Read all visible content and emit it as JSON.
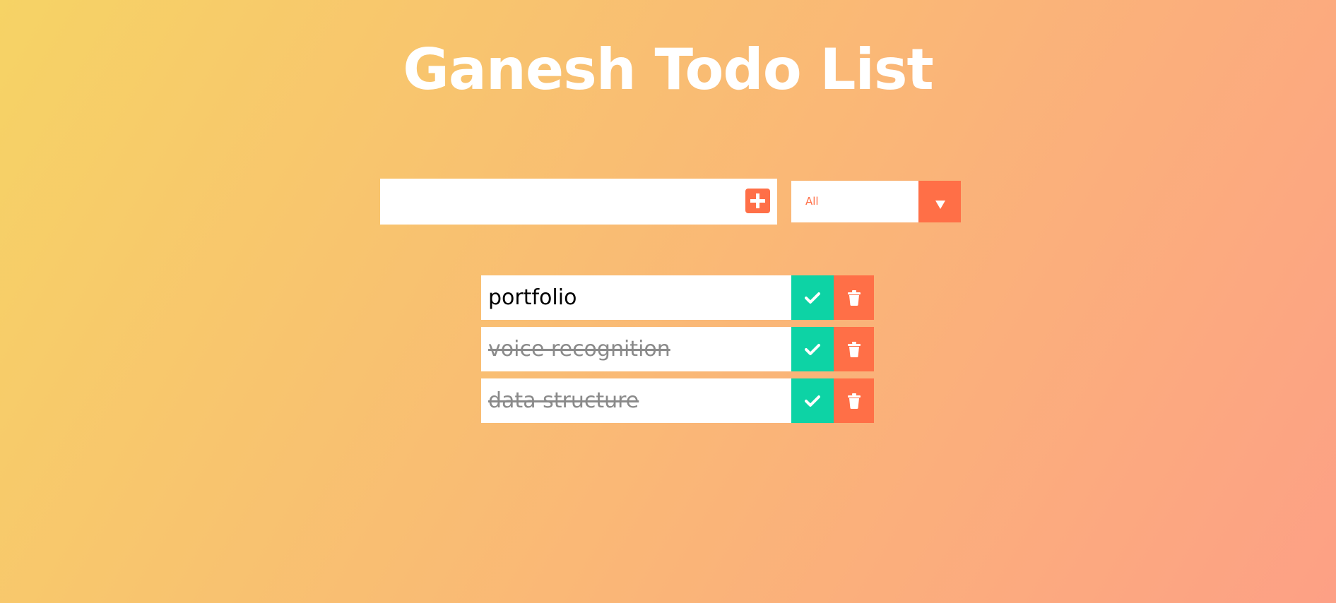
{
  "header": {
    "title": "Ganesh Todo List"
  },
  "form": {
    "input_value": "",
    "input_placeholder": "",
    "add_icon": "plus-icon"
  },
  "filter": {
    "selected": "All",
    "arrow_icon": "caret-down-icon"
  },
  "todos": [
    {
      "text": "portfolio",
      "completed": false
    },
    {
      "text": "voice recognition",
      "completed": true
    },
    {
      "text": "data structure",
      "completed": true
    }
  ],
  "icons": {
    "complete": "check-icon",
    "delete": "trash-icon"
  },
  "colors": {
    "gradient_start": "#f6d365",
    "gradient_end": "#fda085",
    "accent": "#ff6f47",
    "complete": "#0dd3a5",
    "title": "#ffffff"
  }
}
